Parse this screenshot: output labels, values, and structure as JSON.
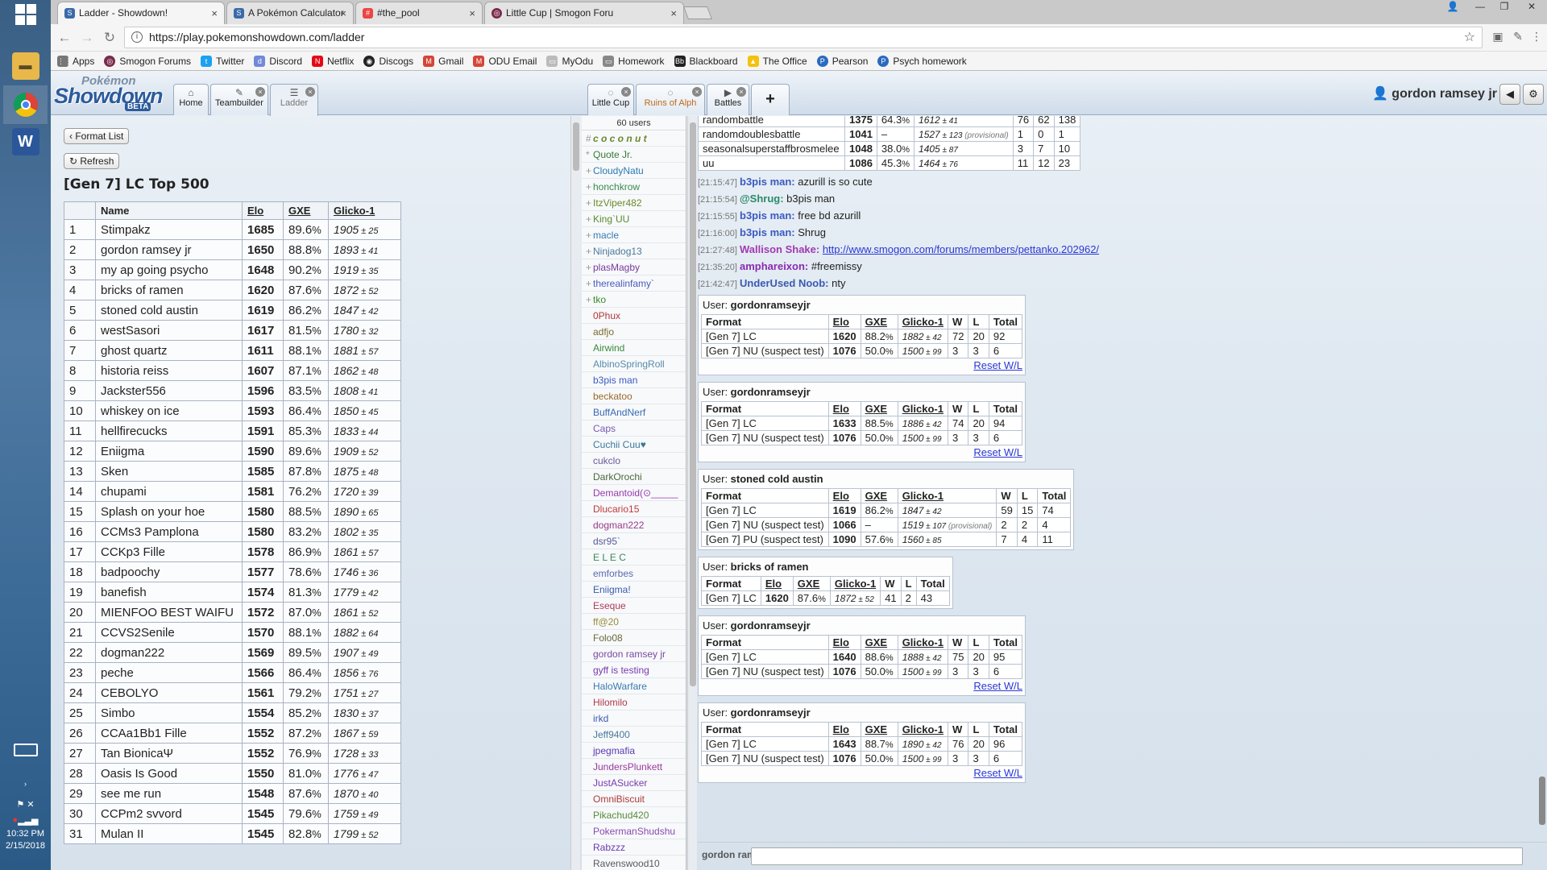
{
  "taskbar": {
    "time": "10:32 PM",
    "date": "2/15/2018"
  },
  "browser": {
    "tabs": [
      {
        "title": "Ladder - Showdown!",
        "active": true
      },
      {
        "title": "A Pokémon Calculator",
        "active": false
      },
      {
        "title": "#the_pool",
        "active": false
      },
      {
        "title": "Little Cup | Smogon Foru",
        "active": false
      }
    ],
    "url": "https://play.pokemonshowdown.com/ladder",
    "bookmarks": [
      "Apps",
      "Smogon Forums",
      "Twitter",
      "Discord",
      "Netflix",
      "Discogs",
      "Gmail",
      "ODU Email",
      "MyOdu",
      "Homework",
      "Blackboard",
      "The Office",
      "Pearson",
      "Psych homework"
    ]
  },
  "showdown": {
    "logo": {
      "top": "Pokémon",
      "main": "Showdown",
      "beta": "BETA"
    },
    "main_tabs": [
      {
        "label": "Home",
        "icon": "⌂"
      },
      {
        "label": "Teambuilder",
        "icon": "✎"
      },
      {
        "label": "Ladder",
        "icon": "☰"
      }
    ],
    "room_tabs": [
      {
        "label": "Little Cup",
        "icon": "💬"
      },
      {
        "label": "Ruins of Alph",
        "icon": "💬"
      },
      {
        "label": "Battles",
        "icon": "▶"
      }
    ],
    "username": "gordon ramsey jr"
  },
  "ladder": {
    "format_list_label": "Format List",
    "refresh_label": "Refresh",
    "title": "[Gen 7] LC Top 500",
    "headers": [
      "Name",
      "Elo",
      "GXE",
      "Glicko-1"
    ],
    "rows": [
      [
        "1",
        "Stimpakz",
        "1685",
        "89.6",
        "1905",
        "25"
      ],
      [
        "2",
        "gordon ramsey jr",
        "1650",
        "88.8",
        "1893",
        "41"
      ],
      [
        "3",
        "my ap going psycho",
        "1648",
        "90.2",
        "1919",
        "35"
      ],
      [
        "4",
        "bricks of ramen",
        "1620",
        "87.6",
        "1872",
        "52"
      ],
      [
        "5",
        "stoned cold austin",
        "1619",
        "86.2",
        "1847",
        "42"
      ],
      [
        "6",
        "westSasori",
        "1617",
        "81.5",
        "1780",
        "32"
      ],
      [
        "7",
        "ghost quartz",
        "1611",
        "88.1",
        "1881",
        "57"
      ],
      [
        "8",
        "historia reiss",
        "1607",
        "87.1",
        "1862",
        "48"
      ],
      [
        "9",
        "Jackster556",
        "1596",
        "83.5",
        "1808",
        "41"
      ],
      [
        "10",
        "whiskey on ice",
        "1593",
        "86.4",
        "1850",
        "45"
      ],
      [
        "11",
        "hellfirecucks",
        "1591",
        "85.3",
        "1833",
        "44"
      ],
      [
        "12",
        "Eniigma",
        "1590",
        "89.6",
        "1909",
        "52"
      ],
      [
        "13",
        "Sken",
        "1585",
        "87.8",
        "1875",
        "48"
      ],
      [
        "14",
        "chupami",
        "1581",
        "76.2",
        "1720",
        "39"
      ],
      [
        "15",
        "Splash on your hoe",
        "1580",
        "88.5",
        "1890",
        "65"
      ],
      [
        "16",
        "CCMs3 Pamplona",
        "1580",
        "83.2",
        "1802",
        "35"
      ],
      [
        "17",
        "CCKp3 Fille",
        "1578",
        "86.9",
        "1861",
        "57"
      ],
      [
        "18",
        "badpoochy",
        "1577",
        "78.6",
        "1746",
        "36"
      ],
      [
        "19",
        "banefish",
        "1574",
        "81.3",
        "1779",
        "42"
      ],
      [
        "20",
        "MIENFOO BEST WAIFU",
        "1572",
        "87.0",
        "1861",
        "52"
      ],
      [
        "21",
        "CCVS2Senile",
        "1570",
        "88.1",
        "1882",
        "64"
      ],
      [
        "22",
        "dogman222",
        "1569",
        "89.5",
        "1907",
        "49"
      ],
      [
        "23",
        "peche",
        "1566",
        "86.4",
        "1856",
        "76"
      ],
      [
        "24",
        "CEBOLYO",
        "1561",
        "79.2",
        "1751",
        "27"
      ],
      [
        "25",
        "Simbo",
        "1554",
        "85.2",
        "1830",
        "37"
      ],
      [
        "26",
        "CCAa1Bb1 Fille",
        "1552",
        "87.2",
        "1867",
        "59"
      ],
      [
        "27",
        "Tan BionicaΨ",
        "1552",
        "76.9",
        "1728",
        "33"
      ],
      [
        "28",
        "Oasis Is Good",
        "1550",
        "81.0",
        "1776",
        "47"
      ],
      [
        "29",
        "see me run",
        "1548",
        "87.6",
        "1870",
        "40"
      ],
      [
        "30",
        "CCPm2 svvord",
        "1545",
        "79.6",
        "1759",
        "49"
      ],
      [
        "31",
        "Mulan II",
        "1545",
        "82.8",
        "1799",
        "52"
      ]
    ]
  },
  "userlist": {
    "count": "60 users",
    "users": [
      [
        "#",
        "c o c o n u t",
        "#6a8a2a"
      ],
      [
        "*",
        "Quote Jr.",
        "#3a7a3a"
      ],
      [
        "+",
        "CloudyNatu",
        "#2a7ab0"
      ],
      [
        "+",
        "honchkrow",
        "#3a8a4a"
      ],
      [
        "+",
        "ItzViper482",
        "#6a8a2a"
      ],
      [
        "+",
        "King`UU",
        "#5a8a2a"
      ],
      [
        "+",
        "macle",
        "#3a7ab0"
      ],
      [
        "+",
        "Ninjadog13",
        "#4a7a9a"
      ],
      [
        "+",
        "plasMagby",
        "#7a3aa0"
      ],
      [
        "+",
        "therealinfamy`",
        "#4a5ac0"
      ],
      [
        "+",
        "tko",
        "#3a8a2a"
      ],
      [
        "",
        "0Phux",
        "#b03a3a"
      ],
      [
        "",
        "adfjo",
        "#7a6a2a"
      ],
      [
        "",
        "Airwind",
        "#3a8a3a"
      ],
      [
        "",
        "AlbinoSpringRoll",
        "#5a8aaa"
      ],
      [
        "",
        "b3pis man",
        "#3a5ac0"
      ],
      [
        "",
        "beckatoo",
        "#9a6a2a"
      ],
      [
        "",
        "BuffAndNerf",
        "#3a6ab0"
      ],
      [
        "",
        "Caps",
        "#7a5ab0"
      ],
      [
        "",
        "Cuchii Cuu♥",
        "#3a7a9a"
      ],
      [
        "",
        "cukclo",
        "#6a5a9a"
      ],
      [
        "",
        "DarkOrochi",
        "#4a6a3a"
      ],
      [
        "",
        "Demantoid(⊙_____",
        "#9a3ab0"
      ],
      [
        "",
        "Dlucario15",
        "#c03a3a"
      ],
      [
        "",
        "dogman222",
        "#9a3a8a"
      ],
      [
        "",
        "dsr95`",
        "#5a5a9a"
      ],
      [
        "",
        "E L E C",
        "#3a8a5a"
      ],
      [
        "",
        "emforbes",
        "#5a6ab0"
      ],
      [
        "",
        "Eniigma!",
        "#3a5ab0"
      ],
      [
        "",
        "Eseque",
        "#b03a5a"
      ],
      [
        "",
        "ff@20",
        "#9a8a3a"
      ],
      [
        "",
        "Folo08",
        "#6a6a3a"
      ],
      [
        "",
        "gordon ramsey jr",
        "#7a4aa0"
      ],
      [
        "",
        "gyff is testing",
        "#7a3ab0"
      ],
      [
        "",
        "HaloWarfare",
        "#3a7ab0"
      ],
      [
        "",
        "Hilomilo",
        "#b03a4a"
      ],
      [
        "",
        "irkd",
        "#3a5ab0"
      ],
      [
        "",
        "Jeff9400",
        "#4a7a9a"
      ],
      [
        "",
        "jpegmafia",
        "#5a3ab0"
      ],
      [
        "",
        "JundersPlunkett",
        "#9a3a9a"
      ],
      [
        "",
        "JustASucker",
        "#7a3ab0"
      ],
      [
        "",
        "OmniBiscuit",
        "#b03a3a"
      ],
      [
        "",
        "Pikachud420",
        "#5a8a3a"
      ],
      [
        "",
        "PokermanShudshu",
        "#8a4ab0"
      ],
      [
        "",
        "Rabzzz",
        "#6a3ab0"
      ],
      [
        "",
        "Ravenswood10",
        "#5a5a5a"
      ]
    ]
  },
  "chat": {
    "top_table": [
      [
        "randombattle",
        "1375",
        "64.3",
        "1612",
        "41",
        "",
        "76",
        "62",
        "138"
      ],
      [
        "randomdoublesbattle",
        "1041",
        "–",
        "1527",
        "123",
        "(provisional)",
        "1",
        "0",
        "1"
      ],
      [
        "seasonalsuperstaffbrosmelee",
        "1048",
        "38.0",
        "1405",
        "87",
        "",
        "3",
        "7",
        "10"
      ],
      [
        "uu",
        "1086",
        "45.3",
        "1464",
        "76",
        "",
        "11",
        "12",
        "23"
      ]
    ],
    "messages": [
      {
        "ts": "[21:15:47]",
        "name": "b3pis man:",
        "color": "#3a5ac0",
        "text": "azurill is so cute",
        "link": ""
      },
      {
        "ts": "[21:15:54]",
        "name": "@Shrug:",
        "color": "#2a8a6a",
        "text": "b3pis man",
        "link": ""
      },
      {
        "ts": "[21:15:55]",
        "name": "b3pis man:",
        "color": "#3a5ac0",
        "text": "free bd azurill",
        "link": ""
      },
      {
        "ts": "[21:16:00]",
        "name": "b3pis man:",
        "color": "#3a5ac0",
        "text": "Shrug",
        "link": ""
      },
      {
        "ts": "[21:27:48]",
        "name": "Wallison Shake:",
        "color": "#a03ab0",
        "text": "",
        "link": "http://www.smogon.com/forums/members/pettanko.202962/"
      },
      {
        "ts": "[21:35:20]",
        "name": "amphareixon:",
        "color": "#8a2ab0",
        "text": "#freemissy",
        "link": ""
      },
      {
        "ts": "[21:42:47]",
        "name": "UnderUsed Noob:",
        "color": "#3a5ab0",
        "text": "nty",
        "link": ""
      }
    ],
    "user_boxes": [
      {
        "user": "gordonramseyjr",
        "reset": "Reset W/L",
        "rows": [
          [
            "[Gen 7] LC",
            "1620",
            "88.2",
            "1882",
            "42",
            "",
            "72",
            "20",
            "92"
          ],
          [
            "[Gen 7] NU (suspect test)",
            "1076",
            "50.0",
            "1500",
            "99",
            "",
            "3",
            "3",
            "6"
          ]
        ]
      },
      {
        "user": "gordonramseyjr",
        "reset": "Reset W/L",
        "rows": [
          [
            "[Gen 7] LC",
            "1633",
            "88.5",
            "1886",
            "42",
            "",
            "74",
            "20",
            "94"
          ],
          [
            "[Gen 7] NU (suspect test)",
            "1076",
            "50.0",
            "1500",
            "99",
            "",
            "3",
            "3",
            "6"
          ]
        ]
      },
      {
        "user": "stoned cold austin",
        "reset": "",
        "rows": [
          [
            "[Gen 7] LC",
            "1619",
            "86.2",
            "1847",
            "42",
            "",
            "59",
            "15",
            "74"
          ],
          [
            "[Gen 7] NU (suspect test)",
            "1066",
            "–",
            "1519",
            "107",
            "(provisional)",
            "2",
            "2",
            "4"
          ],
          [
            "[Gen 7] PU (suspect test)",
            "1090",
            "57.6",
            "1560",
            "85",
            "",
            "7",
            "4",
            "11"
          ]
        ]
      },
      {
        "user": "bricks of ramen",
        "reset": "",
        "rows": [
          [
            "[Gen 7] LC",
            "1620",
            "87.6",
            "1872",
            "52",
            "",
            "41",
            "2",
            "43"
          ]
        ]
      },
      {
        "user": "gordonramseyjr",
        "reset": "Reset W/L",
        "rows": [
          [
            "[Gen 7] LC",
            "1640",
            "88.6",
            "1888",
            "42",
            "",
            "75",
            "20",
            "95"
          ],
          [
            "[Gen 7] NU (suspect test)",
            "1076",
            "50.0",
            "1500",
            "99",
            "",
            "3",
            "3",
            "6"
          ]
        ]
      },
      {
        "user": "gordonramseyjr",
        "reset": "Reset W/L",
        "rows": [
          [
            "[Gen 7] LC",
            "1643",
            "88.7",
            "1890",
            "42",
            "",
            "76",
            "20",
            "96"
          ],
          [
            "[Gen 7] NU (suspect test)",
            "1076",
            "50.0",
            "1500",
            "99",
            "",
            "3",
            "3",
            "6"
          ]
        ]
      }
    ],
    "box_user_label": "User:",
    "box_headers": [
      "Format",
      "Elo",
      "GXE",
      "Glicko-1",
      "W",
      "L",
      "Total"
    ],
    "input_name": "gordon ram:"
  }
}
